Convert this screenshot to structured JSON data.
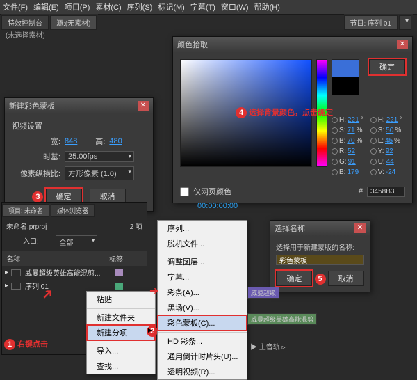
{
  "menubar": [
    "文件(F)",
    "编辑(E)",
    "项目(P)",
    "素材(C)",
    "序列(S)",
    "标记(M)",
    "字幕(T)",
    "窗口(W)",
    "帮助(H)"
  ],
  "top_tabs": {
    "left1": "特效控制台",
    "left2": "源:(无素材)",
    "right": "节目: 序列 01",
    "dropdown": "▾"
  },
  "no_select": "(未选择素材)",
  "new_matte": {
    "title": "新建彩色蒙板",
    "section": "视频设置",
    "width_label": "宽:",
    "width": "848",
    "height_label": "高:",
    "height": "480",
    "timebase_label": "时基:",
    "timebase": "25.00fps",
    "par_label": "像素纵横比:",
    "par": "方形像素 (1.0)",
    "ok": "确定",
    "cancel": "取消"
  },
  "color_picker": {
    "title": "颜色拾取",
    "ok": "确定",
    "web_only": "仅网页颜色",
    "hex_prefix": "#",
    "hex": "3458B3",
    "annotation": "选择背景颜色，点击确定",
    "hsb": [
      {
        "k": "H:",
        "v": "221",
        "u": "°"
      },
      {
        "k": "S:",
        "v": "71",
        "u": "%"
      },
      {
        "k": "B:",
        "v": "70",
        "u": "%"
      },
      {
        "k": "R:",
        "v": "52",
        "u": ""
      },
      {
        "k": "G:",
        "v": "91",
        "u": ""
      },
      {
        "k": "B:",
        "v": "179",
        "u": ""
      }
    ],
    "hsl": [
      {
        "k": "H:",
        "v": "221",
        "u": "°"
      },
      {
        "k": "S:",
        "v": "50",
        "u": "%"
      },
      {
        "k": "L:",
        "v": "45",
        "u": "%"
      },
      {
        "k": "Y:",
        "v": "92",
        "u": ""
      },
      {
        "k": "U:",
        "v": "44",
        "u": ""
      },
      {
        "k": "V:",
        "v": "-24",
        "u": ""
      }
    ]
  },
  "choose_name": {
    "title": "选择名称",
    "prompt": "选择用于新建蒙版的名称:",
    "value": "彩色蒙板",
    "ok": "确定",
    "cancel": "取消"
  },
  "project": {
    "tab_l": "项目: 未命名",
    "tab_r": "媒体浏览器",
    "file": "未命名.prproj",
    "count": "2 项",
    "filter_label": "入口:",
    "filter": "全部",
    "col_name": "名称",
    "col_tag": "标签",
    "items": [
      {
        "name": "威曼超级英雄高能混剪...",
        "color": "#a88bbc"
      },
      {
        "name": "序列 01",
        "color": "#4aa87a"
      }
    ]
  },
  "ctx1": {
    "paste": "粘贴",
    "new_folder": "新建文件夹",
    "new_item": "新建分项",
    "import": "导入...",
    "find": "查找..."
  },
  "ctx2": [
    "序列...",
    "脱机文件...",
    "调整图层...",
    "字幕...",
    "彩条(A)...",
    "黑场(V)...",
    "彩色蒙板(C)...",
    "HD 彩条...",
    "通用倒计时片头(U)...",
    "透明视频(R)..."
  ],
  "timeline": {
    "tc": "00:00:00:00",
    "clip1": "威曼超级",
    "clip2": "威曼超级英雄高能混剪",
    "audio": "主音轨"
  },
  "notes": {
    "n1": "右键点击",
    "n2_idx": "2",
    "n3_idx": "3",
    "n4_idx": "4",
    "n5_idx": "5",
    "n1_idx": "1"
  }
}
